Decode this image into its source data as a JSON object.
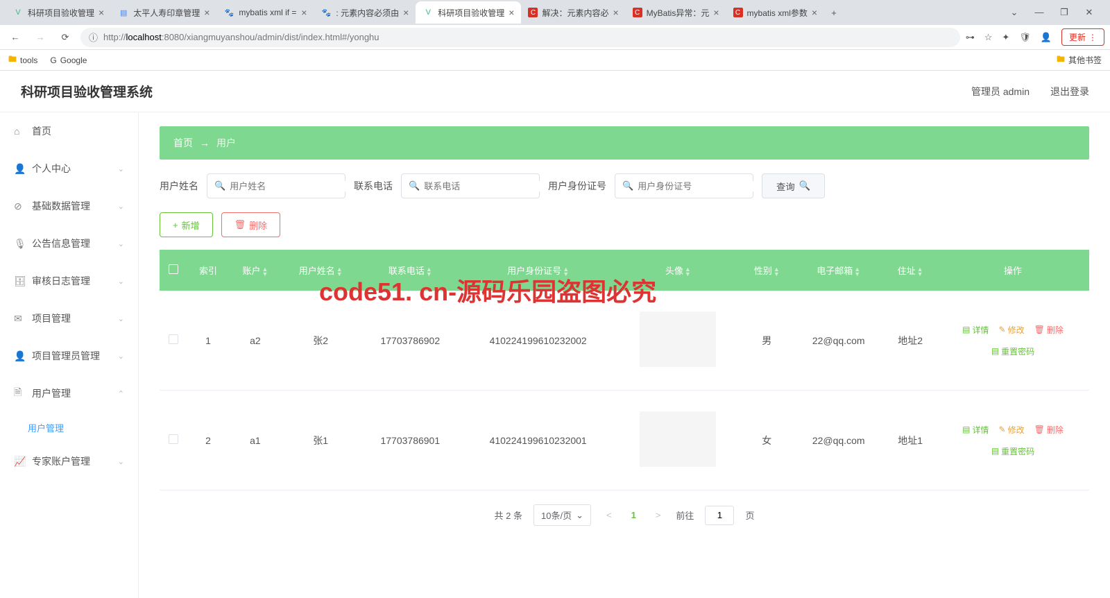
{
  "browser": {
    "tabs": [
      {
        "title": "科研项目验收管理",
        "favicon": "V",
        "favcolor": "#41b883"
      },
      {
        "title": "太平人寿印章管理",
        "favicon": "▤",
        "favcolor": "#4285f4"
      },
      {
        "title": "mybatis xml if =",
        "favicon": "🐾",
        "favcolor": "#4285f4"
      },
      {
        "title": ": 元素内容必须由",
        "favicon": "🐾",
        "favcolor": "#4285f4"
      },
      {
        "title": "科研项目验收管理",
        "favicon": "V",
        "favcolor": "#41b883",
        "active": true
      },
      {
        "title": "解决：元素内容必",
        "favicon": "C",
        "favcolor": "#d93025"
      },
      {
        "title": "MyBatis异常：元",
        "favicon": "C",
        "favcolor": "#d93025"
      },
      {
        "title": "mybatis xml参数",
        "favicon": "C",
        "favcolor": "#d93025"
      }
    ],
    "url_prefix": "http://",
    "url_host": "localhost",
    "url_path": ":8080/xiangmuyanshou/admin/dist/index.html#/yonghu",
    "update": "更新",
    "bookmarks": {
      "tools": "tools",
      "google": "Google",
      "other": "其他书签"
    }
  },
  "app": {
    "title": "科研项目验收管理系统",
    "user_label": "管理员 admin",
    "logout": "退出登录"
  },
  "sidebar": {
    "items": [
      {
        "icon": "⌂",
        "label": "首页"
      },
      {
        "icon": "👤",
        "label": "个人中心",
        "chevron": true
      },
      {
        "icon": "⊘",
        "label": "基础数据管理",
        "chevron": true
      },
      {
        "icon": "🎤",
        "label": "公告信息管理",
        "chevron": true
      },
      {
        "icon": "🗄",
        "label": "审核日志管理",
        "chevron": true
      },
      {
        "icon": "✉",
        "label": "项目管理",
        "chevron": true
      },
      {
        "icon": "👤",
        "label": "项目管理员管理",
        "chevron": true
      },
      {
        "icon": "🗎",
        "label": "用户管理",
        "chevron": true,
        "expanded": true
      },
      {
        "icon": "📈",
        "label": "专家账户管理",
        "chevron": true
      }
    ],
    "submenu": "用户管理"
  },
  "breadcrumb": {
    "home": "首页",
    "arrow": "→",
    "current": "用户"
  },
  "filters": {
    "name_label": "用户姓名",
    "name_ph": "用户姓名",
    "phone_label": "联系电话",
    "phone_ph": "联系电话",
    "id_label": "用户身份证号",
    "id_ph": "用户身份证号",
    "query": "查询"
  },
  "actions": {
    "add": "新增",
    "delete": "删除"
  },
  "table": {
    "headers": [
      "",
      "索引",
      "账户",
      "用户姓名",
      "联系电话",
      "用户身份证号",
      "头像",
      "性别",
      "电子邮箱",
      "住址",
      "操作"
    ],
    "rows": [
      {
        "index": "1",
        "account": "a2",
        "name": "张2",
        "phone": "17703786902",
        "idcard": "410224199610232002",
        "gender": "男",
        "email": "22@qq.com",
        "address": "地址2"
      },
      {
        "index": "2",
        "account": "a1",
        "name": "张1",
        "phone": "17703786901",
        "idcard": "410224199610232001",
        "gender": "女",
        "email": "22@qq.com",
        "address": "地址1"
      }
    ],
    "row_actions": {
      "detail": "详情",
      "edit": "修改",
      "delete": "删除",
      "reset": "重置密码"
    }
  },
  "pagination": {
    "total": "共 2 条",
    "per_page": "10条/页",
    "current": "1",
    "goto": "前往",
    "goto_val": "1",
    "page_suffix": "页"
  },
  "watermark": {
    "main": "code51. cn-源码乐园盗图必究",
    "light": "code51.cn"
  }
}
